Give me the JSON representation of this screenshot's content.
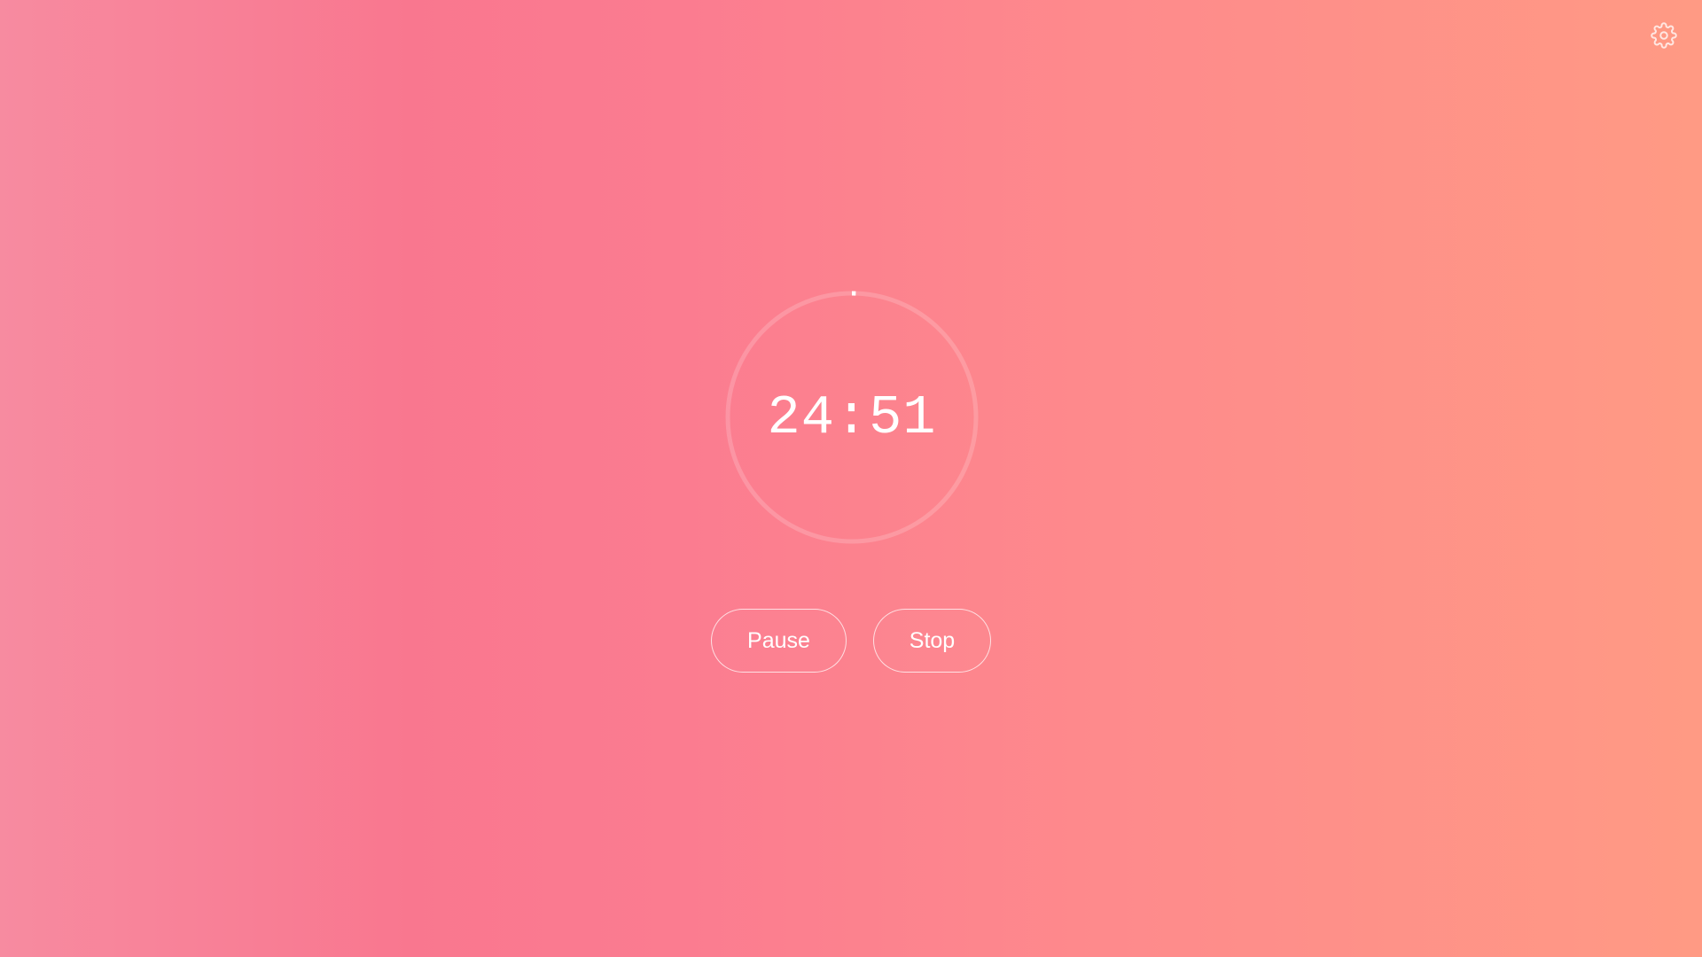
{
  "app": {
    "accent_color": "#ffffff",
    "background_gradient": [
      "#f78ba0",
      "#f9778f",
      "#fb7c90",
      "#fe8a8c",
      "#ff9a84"
    ]
  },
  "header": {
    "settings_icon": "gear-icon"
  },
  "timer": {
    "time_remaining": "24:51",
    "progress_fraction": 0.005
  },
  "controls": {
    "pause_label": "Pause",
    "stop_label": "Stop"
  }
}
